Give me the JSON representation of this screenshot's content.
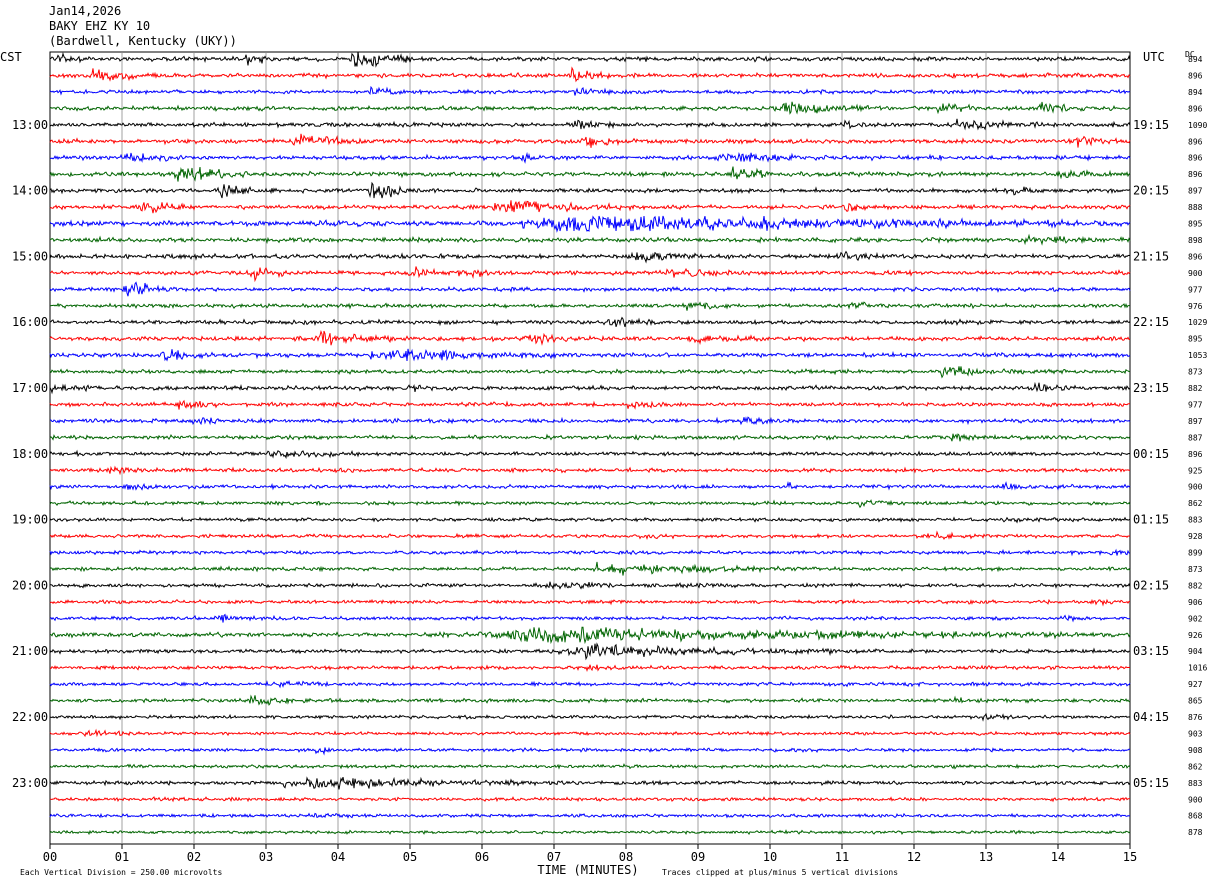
{
  "header": {
    "date": "Jan14,2026",
    "station": "BAKY EHZ KY 10",
    "location": "(Bardwell, Kentucky (UKY))"
  },
  "chart_data": {
    "type": "line",
    "left_axis_label": "CST",
    "right_axis_label": "UTC",
    "dc_label": "DC",
    "left_times": [
      "13:00",
      "14:00",
      "15:00",
      "16:00",
      "17:00",
      "18:00",
      "19:00",
      "20:00",
      "21:00",
      "22:00",
      "23:00"
    ],
    "right_times": [
      "19:15",
      "20:15",
      "21:15",
      "22:15",
      "23:15",
      "00:15",
      "01:15",
      "02:15",
      "03:15",
      "04:15",
      "05:15"
    ],
    "x_ticks": [
      "00",
      "01",
      "02",
      "03",
      "04",
      "05",
      "06",
      "07",
      "08",
      "09",
      "10",
      "11",
      "12",
      "13",
      "14",
      "15"
    ],
    "xlabel": "TIME (MINUTES)",
    "xlim": [
      0,
      15
    ],
    "footer_left": "Each Vertical Division =  250.00 microvolts",
    "footer_right": "Traces clipped at plus/minus 5 vertical divisions",
    "trace_colors": [
      "#000000",
      "#ff0000",
      "#0000ff",
      "#006400"
    ],
    "dc_offsets": [
      "894",
      "896",
      "894",
      "896",
      "1090",
      "896",
      "896",
      "896",
      "897",
      "888",
      "895",
      "898",
      "896",
      "900",
      "977",
      "976",
      "1029",
      "895",
      "1053",
      "873",
      "882",
      "977",
      "897",
      "887",
      "896",
      "925",
      "900",
      "862",
      "883",
      "928",
      "899",
      "873",
      "882",
      "906",
      "902",
      "926",
      "904",
      "1016",
      "927",
      "865",
      "876",
      "903",
      "908",
      "862",
      "883",
      "900",
      "868",
      "878"
    ],
    "traces": [
      {
        "noise": 1.5,
        "events": [
          [
            0.0,
            0.4,
            2.5
          ],
          [
            4.2,
            0.5,
            9.0
          ],
          [
            2.7,
            0.3,
            3.5
          ]
        ]
      },
      {
        "noise": 1.4,
        "events": [
          [
            0.6,
            0.5,
            6.0
          ],
          [
            7.2,
            0.4,
            5.0
          ]
        ]
      },
      {
        "noise": 1.3,
        "events": [
          [
            4.4,
            0.3,
            3.0
          ],
          [
            7.3,
            0.4,
            2.5
          ]
        ]
      },
      {
        "noise": 1.4,
        "events": [
          [
            10.1,
            0.9,
            4.5
          ],
          [
            12.3,
            0.4,
            4.0
          ],
          [
            13.7,
            0.5,
            4.0
          ]
        ]
      },
      {
        "noise": 1.4,
        "events": [
          [
            7.3,
            0.4,
            3.0
          ],
          [
            11.0,
            0.3,
            3.0
          ],
          [
            12.6,
            0.8,
            3.5
          ]
        ]
      },
      {
        "noise": 1.4,
        "events": [
          [
            3.4,
            0.6,
            5.0
          ],
          [
            7.4,
            0.5,
            3.0
          ],
          [
            14.2,
            0.5,
            3.0
          ]
        ]
      },
      {
        "noise": 1.4,
        "events": [
          [
            1.0,
            0.5,
            4.0
          ],
          [
            6.5,
            0.5,
            2.5
          ],
          [
            9.3,
            1.1,
            4.0
          ]
        ]
      },
      {
        "noise": 1.5,
        "events": [
          [
            1.7,
            0.7,
            6.0
          ],
          [
            9.4,
            0.5,
            5.0
          ],
          [
            14.0,
            0.5,
            3.0
          ]
        ]
      },
      {
        "noise": 1.4,
        "events": [
          [
            2.3,
            0.5,
            4.5
          ],
          [
            4.4,
            0.5,
            7.0
          ],
          [
            13.3,
            0.4,
            3.0
          ]
        ]
      },
      {
        "noise": 1.4,
        "events": [
          [
            1.2,
            0.5,
            4.5
          ],
          [
            6.2,
            1.2,
            4.5
          ],
          [
            11.0,
            0.3,
            2.5
          ]
        ]
      },
      {
        "noise": 1.8,
        "events": [
          [
            6.6,
            4.8,
            6.0
          ]
        ]
      },
      {
        "noise": 1.5,
        "events": [
          [
            13.5,
            1.0,
            2.5
          ]
        ]
      },
      {
        "noise": 1.5,
        "events": [
          [
            8.1,
            0.6,
            5.0
          ],
          [
            10.9,
            0.4,
            3.0
          ]
        ]
      },
      {
        "noise": 1.4,
        "events": [
          [
            2.8,
            0.4,
            4.5
          ],
          [
            5.0,
            0.4,
            3.5
          ],
          [
            5.6,
            0.5,
            3.0
          ],
          [
            8.5,
            0.8,
            3.0
          ]
        ]
      },
      {
        "noise": 1.3,
        "events": [
          [
            1.0,
            0.5,
            6.5
          ]
        ]
      },
      {
        "noise": 1.3,
        "events": [
          [
            8.8,
            0.5,
            4.5
          ],
          [
            11.1,
            0.3,
            2.5
          ]
        ]
      },
      {
        "noise": 1.4,
        "events": [
          [
            7.7,
            0.6,
            3.0
          ],
          [
            12.4,
            0.3,
            2.0
          ]
        ]
      },
      {
        "noise": 1.4,
        "events": [
          [
            3.7,
            0.7,
            5.5
          ],
          [
            6.6,
            0.6,
            4.0
          ],
          [
            8.8,
            0.8,
            3.0
          ]
        ]
      },
      {
        "noise": 1.4,
        "events": [
          [
            1.5,
            0.5,
            4.0
          ],
          [
            4.5,
            1.8,
            3.5
          ]
        ]
      },
      {
        "noise": 1.3,
        "events": [
          [
            12.3,
            0.8,
            3.5
          ]
        ]
      },
      {
        "noise": 1.4,
        "events": [
          [
            0.0,
            0.4,
            3.5
          ],
          [
            4.9,
            0.5,
            2.0
          ],
          [
            13.6,
            0.6,
            3.0
          ]
        ]
      },
      {
        "noise": 1.3,
        "events": [
          [
            1.7,
            0.5,
            3.5
          ],
          [
            8.0,
            0.4,
            3.5
          ]
        ]
      },
      {
        "noise": 1.3,
        "events": [
          [
            2.0,
            0.4,
            2.5
          ],
          [
            9.6,
            0.4,
            2.5
          ]
        ]
      },
      {
        "noise": 1.3,
        "events": [
          [
            12.5,
            0.4,
            2.5
          ]
        ]
      },
      {
        "noise": 1.3,
        "events": [
          [
            3.0,
            0.8,
            2.5
          ]
        ]
      },
      {
        "noise": 1.3,
        "events": [
          [
            0.8,
            0.3,
            2.0
          ]
        ]
      },
      {
        "noise": 1.3,
        "events": [
          [
            1.0,
            0.3,
            2.0
          ],
          [
            10.2,
            0.3,
            2.0
          ],
          [
            13.2,
            0.4,
            2.0
          ]
        ]
      },
      {
        "noise": 1.2,
        "events": [
          [
            11.2,
            0.4,
            2.0
          ]
        ]
      },
      {
        "noise": 1.2,
        "events": [
          [
            13.2,
            0.4,
            1.5
          ]
        ]
      },
      {
        "noise": 1.2,
        "events": [
          [
            8.2,
            0.4,
            2.0
          ],
          [
            12.2,
            0.5,
            2.0
          ]
        ]
      },
      {
        "noise": 1.2,
        "events": [
          [
            14.7,
            0.3,
            1.5
          ]
        ]
      },
      {
        "noise": 1.2,
        "events": [
          [
            7.6,
            2.4,
            3.0
          ]
        ]
      },
      {
        "noise": 1.2,
        "events": [
          [
            6.7,
            2.0,
            1.5
          ]
        ]
      },
      {
        "noise": 1.2,
        "events": [
          [
            14.5,
            0.3,
            1.5
          ]
        ]
      },
      {
        "noise": 1.2,
        "events": [
          [
            2.3,
            0.5,
            2.0
          ],
          [
            14.0,
            0.3,
            1.5
          ]
        ]
      },
      {
        "noise": 1.5,
        "events": [
          [
            6.0,
            5.2,
            5.5
          ]
        ]
      },
      {
        "noise": 1.3,
        "events": [
          [
            7.1,
            2.4,
            5.0
          ]
        ]
      },
      {
        "noise": 1.2,
        "events": [
          [
            7.4,
            0.6,
            1.5
          ]
        ]
      },
      {
        "noise": 1.2,
        "events": [
          [
            3.2,
            0.5,
            1.5
          ]
        ]
      },
      {
        "noise": 1.2,
        "events": [
          [
            2.7,
            0.6,
            3.0
          ],
          [
            12.5,
            0.4,
            2.0
          ]
        ]
      },
      {
        "noise": 1.1,
        "events": [
          [
            12.9,
            0.3,
            1.5
          ]
        ]
      },
      {
        "noise": 1.1,
        "events": [
          [
            0.5,
            0.4,
            2.0
          ]
        ]
      },
      {
        "noise": 1.1,
        "events": [
          [
            3.7,
            0.4,
            2.0
          ]
        ]
      },
      {
        "noise": 1.1,
        "events": [
          [
            12.0,
            0.4,
            1.0
          ]
        ]
      },
      {
        "noise": 1.3,
        "events": [
          [
            3.3,
            2.4,
            4.0
          ]
        ]
      },
      {
        "noise": 1.1,
        "events": [
          [
            1.4,
            0.3,
            1.5
          ]
        ]
      },
      {
        "noise": 1.1,
        "events": [
          [
            3.6,
            0.5,
            2.0
          ]
        ]
      },
      {
        "noise": 1.0,
        "events": []
      }
    ]
  }
}
